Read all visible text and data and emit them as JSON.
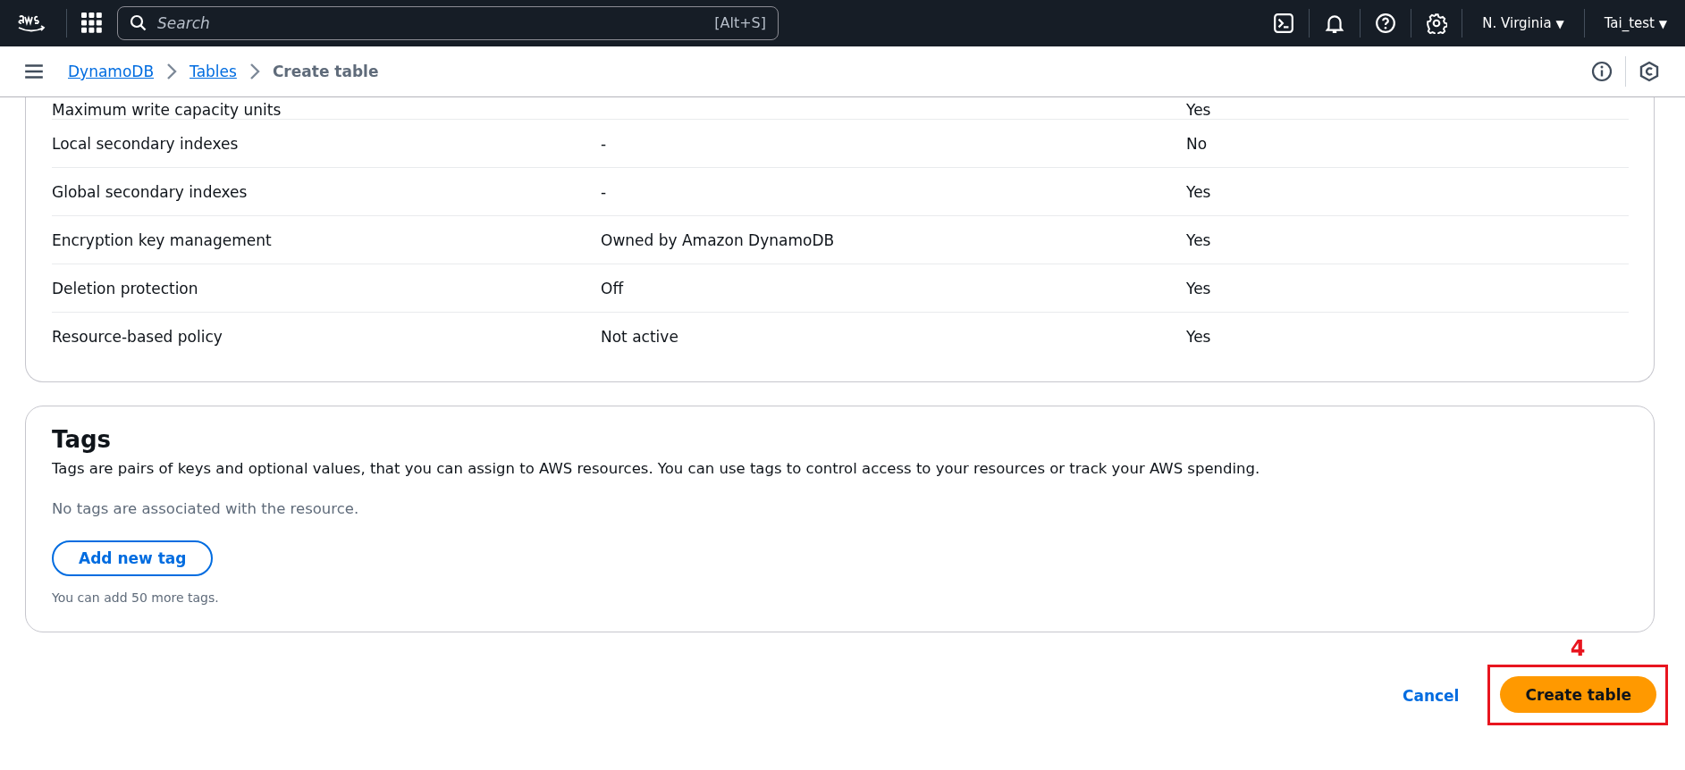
{
  "top_bar": {
    "search": {
      "placeholder": "Search",
      "shortcut": "[Alt+S]"
    },
    "region": "N. Virginia",
    "account": "Tai_test",
    "menu_caret": "▼"
  },
  "breadcrumbs": [
    {
      "label": "DynamoDB",
      "kind": "link"
    },
    {
      "label": "Tables",
      "kind": "link"
    },
    {
      "label": "Create table",
      "kind": "current"
    }
  ],
  "settings_table": {
    "rows": [
      {
        "setting": "Maximum write capacity units",
        "value": "",
        "editable": "Yes"
      },
      {
        "setting": "Local secondary indexes",
        "value": "-",
        "editable": "No"
      },
      {
        "setting": "Global secondary indexes",
        "value": "-",
        "editable": "Yes"
      },
      {
        "setting": "Encryption key management",
        "value": "Owned by Amazon DynamoDB",
        "editable": "Yes"
      },
      {
        "setting": "Deletion protection",
        "value": "Off",
        "editable": "Yes"
      },
      {
        "setting": "Resource-based policy",
        "value": "Not active",
        "editable": "Yes"
      }
    ]
  },
  "tags": {
    "title": "Tags",
    "description": "Tags are pairs of keys and optional values, that you can assign to AWS resources. You can use tags to control access to your resources or track your AWS spending.",
    "empty_message": "No tags are associated with the resource.",
    "add_button": "Add new tag",
    "hint": "You can add 50 more tags."
  },
  "actions": {
    "cancel": "Cancel",
    "create": "Create table",
    "annotation": "4"
  }
}
